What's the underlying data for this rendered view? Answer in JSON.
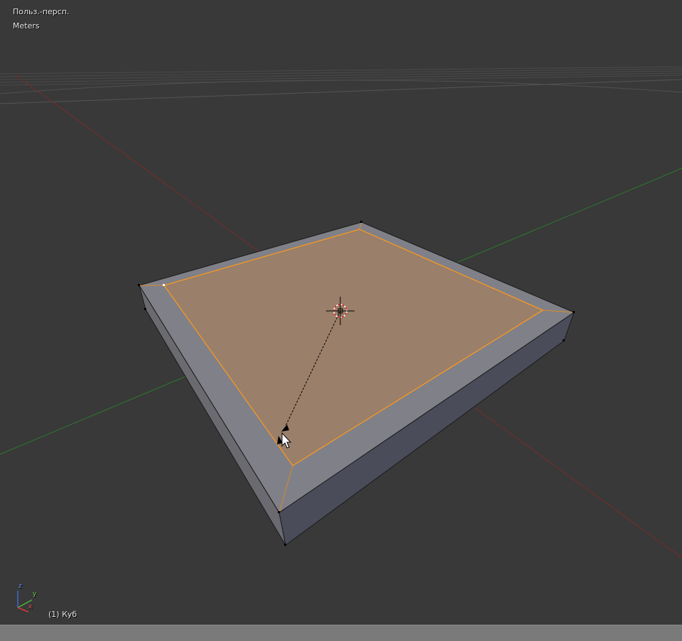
{
  "viewport": {
    "view_name": "Польз.-персп.",
    "units": "Meters",
    "object_info": "(1) Куб"
  },
  "axis_gizmo": {
    "x_label": "x",
    "y_label": "y",
    "z_label": "z",
    "x_color": "#d23a3a",
    "y_color": "#4fb33b",
    "z_color": "#3a6ad6"
  },
  "colors": {
    "background": "#393939",
    "selected_face": "#9a7f6a",
    "selection_edge": "#ff9a1a",
    "mesh_top": "#808087",
    "mesh_side_left": "#6b6b72",
    "mesh_side_front": "#4a4c5a",
    "x_axis": "#8a2e2e",
    "y_axis": "#2f7a2f",
    "statusbar": "#7a7a7a"
  },
  "icons": [
    "3d-cursor-icon",
    "mouse-cursor-icon",
    "axis-gizmo-icon"
  ]
}
